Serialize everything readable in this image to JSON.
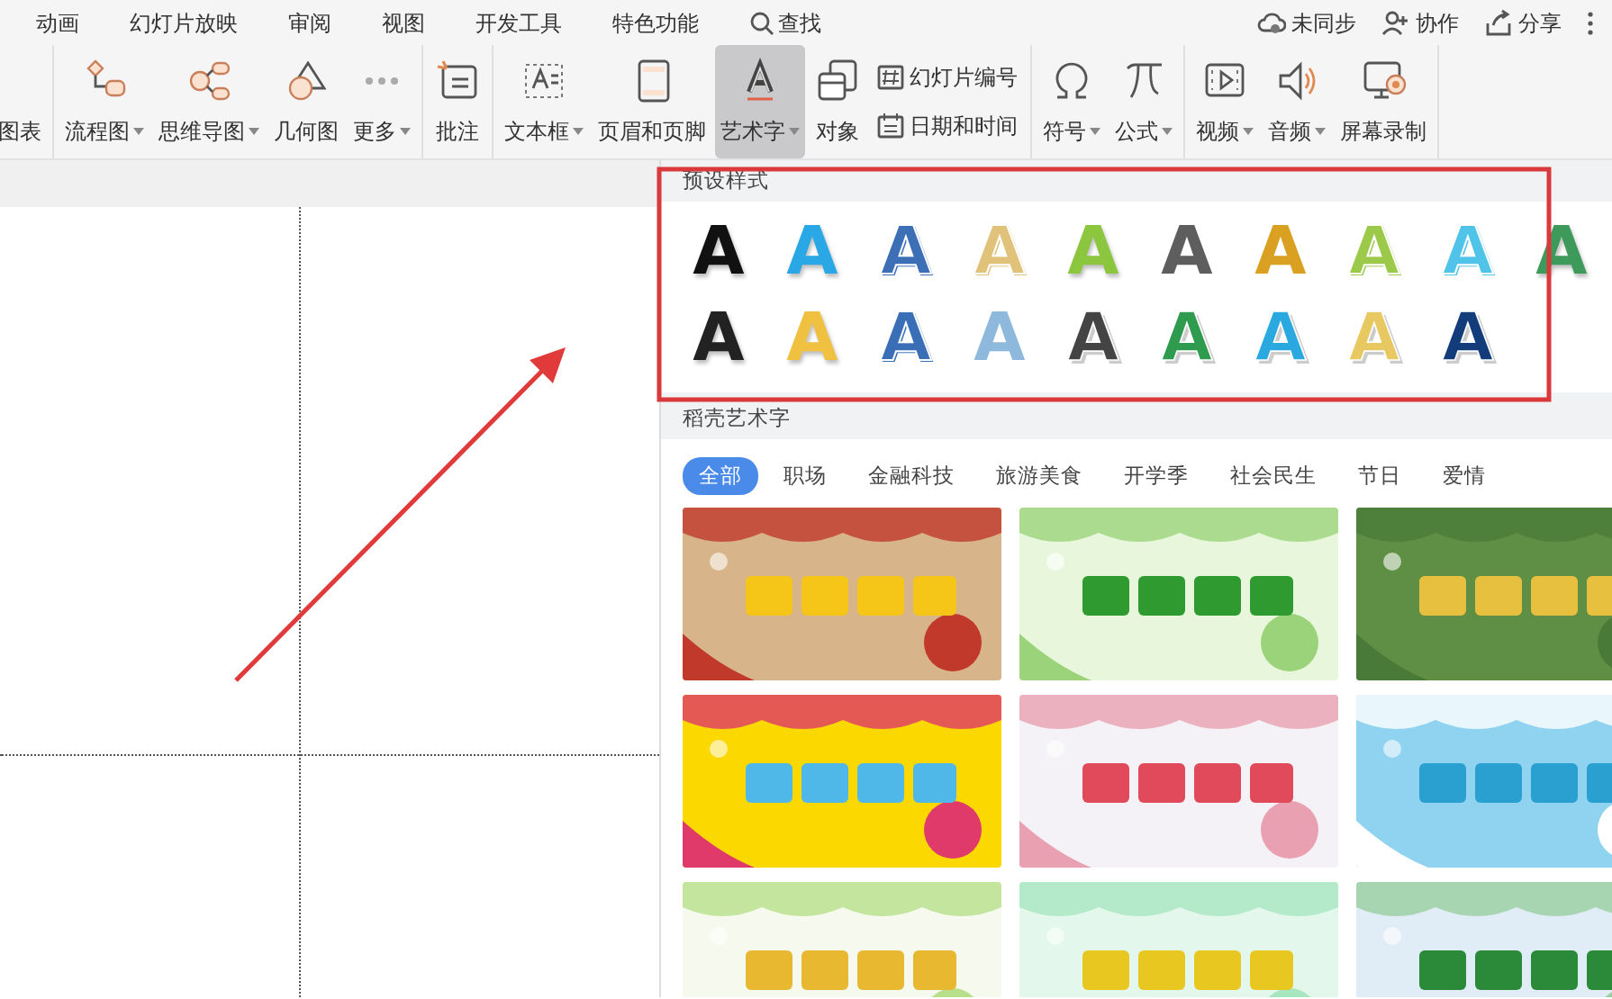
{
  "menu": {
    "items": [
      {
        "label": "动画",
        "kind": "tab"
      },
      {
        "label": "幻灯片放映",
        "kind": "tab"
      },
      {
        "label": "审阅",
        "kind": "tab"
      },
      {
        "label": "视图",
        "kind": "tab"
      },
      {
        "label": "开发工具",
        "kind": "tab"
      },
      {
        "label": "特色功能",
        "kind": "tab"
      },
      {
        "label": "查找",
        "kind": "search"
      }
    ],
    "right": [
      {
        "label": "未同步"
      },
      {
        "label": "协作"
      },
      {
        "label": "分享"
      }
    ]
  },
  "toolbar": {
    "groups": [
      {
        "items": [
          {
            "kind": "cut",
            "label": "图表",
            "dropdown": false,
            "selected": false
          }
        ]
      },
      {
        "items": [
          {
            "kind": "large",
            "label": "流程图",
            "dropdown": true,
            "selected": false
          },
          {
            "kind": "large",
            "label": "思维导图",
            "dropdown": true,
            "selected": false
          },
          {
            "kind": "large",
            "label": "几何图",
            "dropdown": false,
            "selected": false
          },
          {
            "kind": "large",
            "label": "更多",
            "dropdown": true,
            "selected": false
          }
        ]
      },
      {
        "items": [
          {
            "kind": "large",
            "label": "批注",
            "dropdown": false,
            "selected": false
          }
        ]
      },
      {
        "items": [
          {
            "kind": "large",
            "label": "文本框",
            "dropdown": true,
            "selected": false
          },
          {
            "kind": "large",
            "label": "页眉和页脚",
            "dropdown": false,
            "selected": false
          },
          {
            "kind": "large",
            "label": "艺术字",
            "dropdown": true,
            "selected": true
          },
          {
            "kind": "large",
            "label": "对象",
            "dropdown": false,
            "selected": false
          },
          {
            "kind": "stack",
            "entries": [
              {
                "label": "幻灯片编号"
              },
              {
                "label": "日期和时间"
              }
            ]
          }
        ]
      },
      {
        "items": [
          {
            "kind": "large",
            "label": "符号",
            "dropdown": true,
            "selected": false
          },
          {
            "kind": "large",
            "label": "公式",
            "dropdown": true,
            "selected": false
          }
        ]
      },
      {
        "items": [
          {
            "kind": "large",
            "label": "视频",
            "dropdown": true,
            "selected": false
          },
          {
            "kind": "large",
            "label": "音频",
            "dropdown": true,
            "selected": false
          },
          {
            "kind": "large",
            "label": "屏幕录制",
            "dropdown": false,
            "selected": false
          }
        ]
      }
    ]
  },
  "panel": {
    "preset_title": "预设样式",
    "presets": [
      {
        "glyph": "A",
        "kind": "solid",
        "color": "#111111"
      },
      {
        "glyph": "A",
        "kind": "solid",
        "color": "#2aa8e6"
      },
      {
        "glyph": "A",
        "kind": "outline",
        "color": "#3c6fb6"
      },
      {
        "glyph": "A",
        "kind": "outline",
        "color": "#e0c27a"
      },
      {
        "glyph": "A",
        "kind": "solid",
        "color": "#8cc63f"
      },
      {
        "glyph": "A",
        "kind": "gradient",
        "color": "#5e5e5e"
      },
      {
        "glyph": "A",
        "kind": "gradient",
        "color": "#d9a022"
      },
      {
        "glyph": "A",
        "kind": "outline",
        "color": "#9cc94a"
      },
      {
        "glyph": "A",
        "kind": "outline",
        "color": "#4fc3e8"
      },
      {
        "glyph": "A",
        "kind": "solid",
        "color": "#3d9a5a"
      },
      {
        "glyph": "A",
        "kind": "solid",
        "color": "#222222"
      },
      {
        "glyph": "A",
        "kind": "solid",
        "color": "#f0c040"
      },
      {
        "glyph": "A",
        "kind": "outline",
        "color": "#3a6fb8"
      },
      {
        "glyph": "A",
        "kind": "gradient",
        "color": "#8fb9dc"
      },
      {
        "glyph": "A",
        "kind": "striped",
        "color": "#444444"
      },
      {
        "glyph": "A",
        "kind": "striped",
        "color": "#2e9b4e"
      },
      {
        "glyph": "A",
        "kind": "striped",
        "color": "#2aa8e0"
      },
      {
        "glyph": "A",
        "kind": "striped",
        "color": "#e8c860"
      },
      {
        "glyph": "A",
        "kind": "striped",
        "color": "#123d7a"
      }
    ],
    "library_title": "稻壳艺术字",
    "categories": [
      {
        "label": "全部",
        "selected": true
      },
      {
        "label": "职场",
        "selected": false
      },
      {
        "label": "金融科技",
        "selected": false
      },
      {
        "label": "旅游美食",
        "selected": false
      },
      {
        "label": "开学季",
        "selected": false
      },
      {
        "label": "社会民生",
        "selected": false
      },
      {
        "label": "节日",
        "selected": false
      },
      {
        "label": "爱情",
        "selected": false
      }
    ]
  },
  "annotations": {
    "highlight_frame": true,
    "arrow": true
  }
}
